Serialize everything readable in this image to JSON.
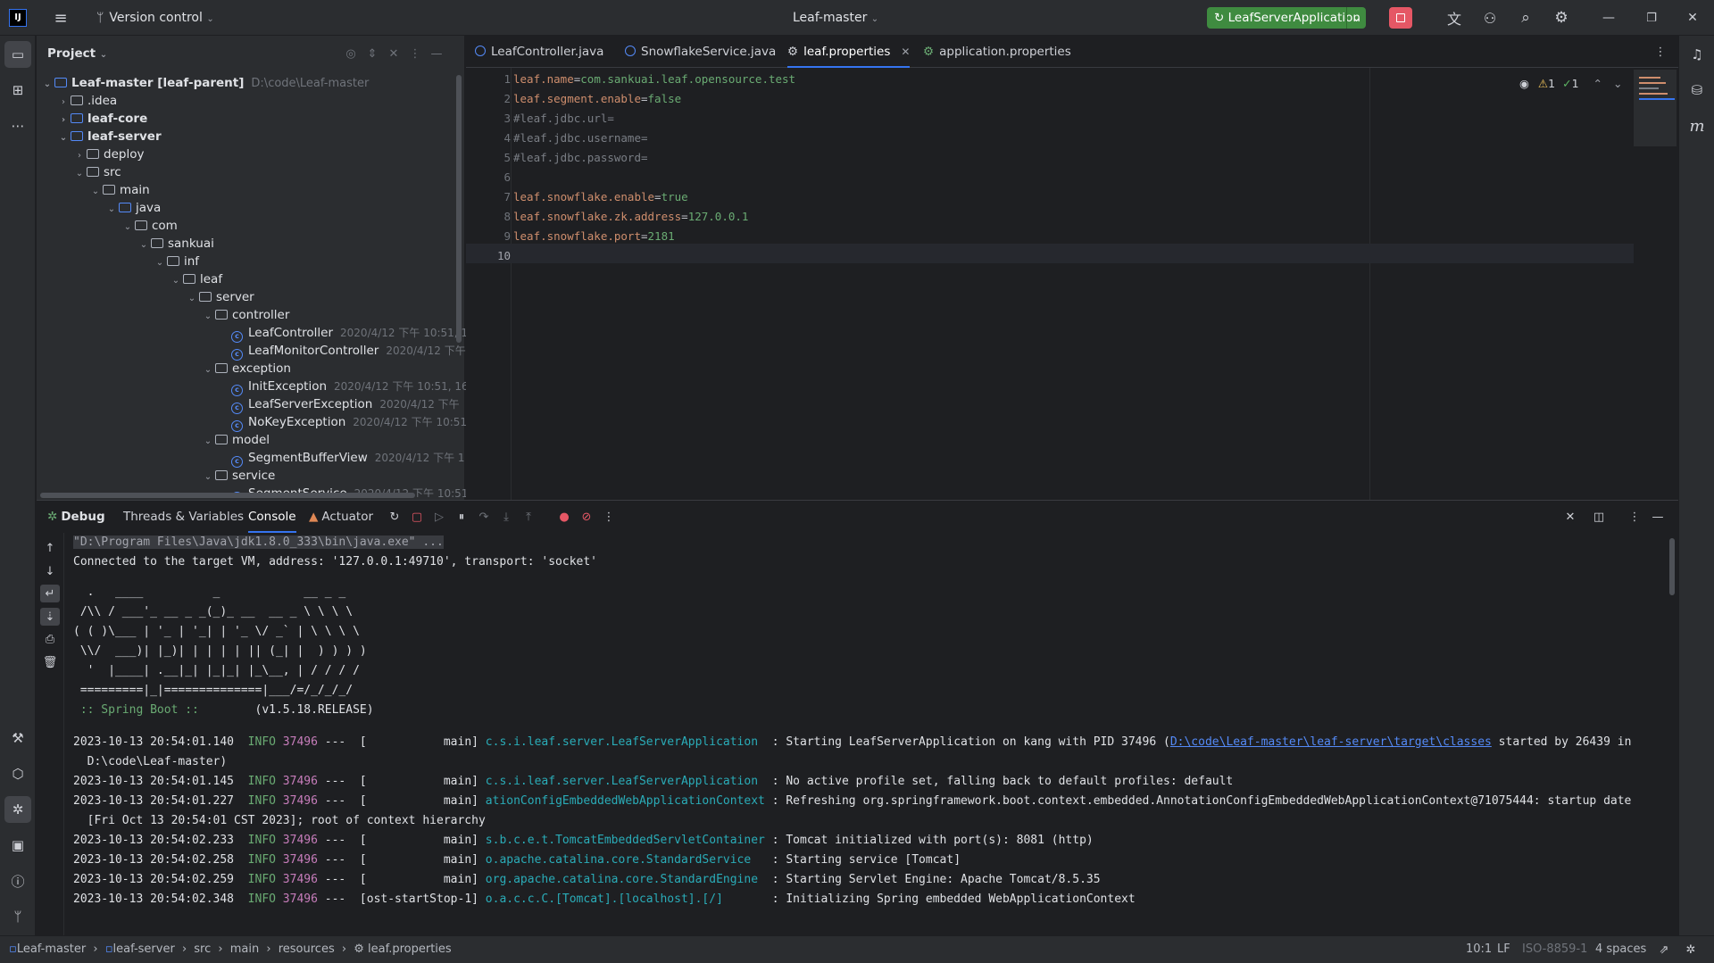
{
  "titlebar": {
    "vcs": "Version control",
    "project": "Leaf-master",
    "run_config": "LeafServerApplication"
  },
  "project_panel": {
    "title": "Project"
  },
  "tree": [
    {
      "label": "Leaf-master",
      "extra": "[leaf-parent]",
      "path": "D:\\code\\Leaf-master",
      "meta": ""
    },
    {
      "label": ".idea",
      "meta": ""
    },
    {
      "label": "leaf-core",
      "meta": ""
    },
    {
      "label": "leaf-server",
      "meta": ""
    },
    {
      "label": "deploy",
      "meta": ""
    },
    {
      "label": "src",
      "meta": ""
    },
    {
      "label": "main",
      "meta": ""
    },
    {
      "label": "java",
      "meta": ""
    },
    {
      "label": "com",
      "meta": ""
    },
    {
      "label": "sankuai",
      "meta": ""
    },
    {
      "label": "inf",
      "meta": ""
    },
    {
      "label": "leaf",
      "meta": ""
    },
    {
      "label": "server",
      "meta": ""
    },
    {
      "label": "controller",
      "meta": ""
    },
    {
      "label": "LeafController",
      "meta": "2020/4/12 下午 10:51, 1."
    },
    {
      "label": "LeafMonitorController",
      "meta": "2020/4/12 下午"
    },
    {
      "label": "exception",
      "meta": ""
    },
    {
      "label": "InitException",
      "meta": "2020/4/12 下午 10:51, 161"
    },
    {
      "label": "LeafServerException",
      "meta": "2020/4/12 下午"
    },
    {
      "label": "NoKeyException",
      "meta": "2020/4/12 下午 10:51"
    },
    {
      "label": "model",
      "meta": ""
    },
    {
      "label": "SegmentBufferView",
      "meta": "2020/4/12 下午 1"
    },
    {
      "label": "service",
      "meta": ""
    },
    {
      "label": "SegmentService",
      "meta": "2020/4/12 下午 10:51,"
    }
  ],
  "tabs": [
    "LeafController.java",
    "SnowflakeService.java",
    "leaf.properties",
    "application.properties"
  ],
  "inspections": {
    "warnings": "1",
    "ok": "1"
  },
  "code": [
    {
      "n": "1",
      "key": "leaf.name",
      "val": "com.sankuai.leaf.opensource.test"
    },
    {
      "n": "2",
      "key": "leaf.segment.enable",
      "val": "false"
    },
    {
      "n": "3",
      "comment": "#leaf.jdbc.url="
    },
    {
      "n": "4",
      "comment": "#leaf.jdbc.username="
    },
    {
      "n": "5",
      "comment": "#leaf.jdbc.password="
    },
    {
      "n": "6"
    },
    {
      "n": "7",
      "key": "leaf.snowflake.enable",
      "val": "true"
    },
    {
      "n": "8",
      "key": "leaf.snowflake.zk.address",
      "val": "127.0.0.1"
    },
    {
      "n": "9",
      "key": "leaf.snowflake.port",
      "val": "2181"
    },
    {
      "n": "10"
    }
  ],
  "debug": {
    "title": "Debug",
    "tabs": [
      "Threads & Variables",
      "Console",
      "Actuator"
    ]
  },
  "console": {
    "cmd": "\"D:\\Program Files\\Java\\jdk1.8.0_333\\bin\\java.exe\" ...",
    "connected": "Connected to the target VM, address: '127.0.0.1:49710', transport: 'socket'",
    "banner": [
      "  .   ____          _            __ _ _",
      " /\\\\ / ___'_ __ _ _(_)_ __  __ _ \\ \\ \\ \\",
      "( ( )\\___ | '_ | '_| | '_ \\/ _` | \\ \\ \\ \\",
      " \\\\/  ___)| |_)| | | | | || (_| |  ) ) ) )",
      "  '  |____| .__|_| |_|_| |_\\__, | / / / /",
      " =========|_|==============|___/=/_/_/_/"
    ],
    "boot": " :: Spring Boot ::        (v1.5.18.RELEASE)",
    "logs": [
      {
        "ts": "2023-10-13 20:54:01.140",
        "lvl": "INFO",
        "pid": "37496",
        "thread": "---  [           main]",
        "logger": "c.s.i.leaf.server.LeafServerApplication",
        "msg": "  : Starting LeafServerApplication on kang with PID 37496 (",
        "link": "D:\\code\\Leaf-master\\leaf-server\\target\\classes",
        "tail": " started by 26439 in",
        "cont": "  D:\\code\\Leaf-master)"
      },
      {
        "ts": "2023-10-13 20:54:01.145",
        "lvl": "INFO",
        "pid": "37496",
        "thread": "---  [           main]",
        "logger": "c.s.i.leaf.server.LeafServerApplication",
        "msg": "  : No active profile set, falling back to default profiles: default"
      },
      {
        "ts": "2023-10-13 20:54:01.227",
        "lvl": "INFO",
        "pid": "37496",
        "thread": "---  [           main]",
        "logger": "ationConfigEmbeddedWebApplicationContext",
        "msg": " : Refreshing org.springframework.boot.context.embedded.AnnotationConfigEmbeddedWebApplicationContext@71075444: startup date",
        "cont": "  [Fri Oct 13 20:54:01 CST 2023]; root of context hierarchy"
      },
      {
        "ts": "2023-10-13 20:54:02.233",
        "lvl": "INFO",
        "pid": "37496",
        "thread": "---  [           main]",
        "logger": "s.b.c.e.t.TomcatEmbeddedServletContainer",
        "msg": " : Tomcat initialized with port(s): 8081 (http)"
      },
      {
        "ts": "2023-10-13 20:54:02.258",
        "lvl": "INFO",
        "pid": "37496",
        "thread": "---  [           main]",
        "logger": "o.apache.catalina.core.StandardService",
        "msg": "   : Starting service [Tomcat]"
      },
      {
        "ts": "2023-10-13 20:54:02.259",
        "lvl": "INFO",
        "pid": "37496",
        "thread": "---  [           main]",
        "logger": "org.apache.catalina.core.StandardEngine",
        "msg": "  : Starting Servlet Engine: Apache Tomcat/8.5.35"
      },
      {
        "ts": "2023-10-13 20:54:02.348",
        "lvl": "INFO",
        "pid": "37496",
        "thread": "---  [ost-startStop-1]",
        "logger": "o.a.c.c.C.[Tomcat].[localhost].[/]",
        "msg": "       : Initializing Spring embedded WebApplicationContext"
      }
    ]
  },
  "breadcrumb": [
    "Leaf-master",
    "leaf-server",
    "src",
    "main",
    "resources",
    "leaf.properties"
  ],
  "status": {
    "pos": "10:1",
    "eol": "LF",
    "encoding": "ISO-8859-1",
    "indent": "4 spaces"
  },
  "colors": {
    "run_button": "#3f8b40",
    "stop": "#e55765",
    "accent": "#3574f0"
  }
}
